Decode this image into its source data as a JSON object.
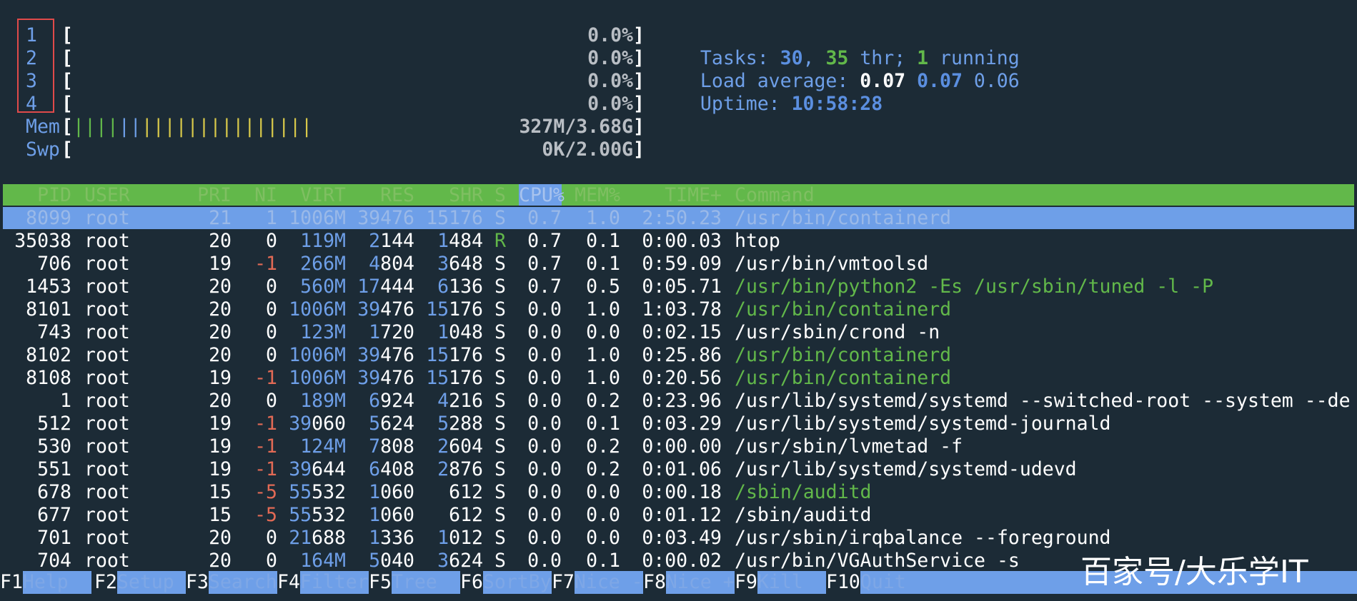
{
  "cpus": [
    {
      "id": "1",
      "usage": "0.0%"
    },
    {
      "id": "2",
      "usage": "0.0%"
    },
    {
      "id": "3",
      "usage": "0.0%"
    },
    {
      "id": "4",
      "usage": "0.0%"
    }
  ],
  "mem": {
    "label": "Mem",
    "bar": "|||||||||||||||||||||",
    "value": "327M/3.68G"
  },
  "swp": {
    "label": "Swp",
    "value": "0K/2.00G"
  },
  "brackets": {
    "open": "[",
    "close": "]"
  },
  "tasks": {
    "label": "Tasks: ",
    "count": "30",
    "sep": ", ",
    "thr": "35",
    "thr_label": " thr; ",
    "running": "1",
    "running_label": " running"
  },
  "load": {
    "label": "Load average: ",
    "v1": "0.07",
    "v2": "0.07",
    "v3": "0.06"
  },
  "uptime": {
    "label": "Uptime: ",
    "value": "10:58:28"
  },
  "columns": {
    "pid": "PID",
    "user": "USER",
    "pri": "PRI",
    "ni": "NI",
    "virt": "VIRT",
    "res": "RES",
    "shr": "SHR",
    "s": "S",
    "cpu": "CPU%",
    "mem": "MEM%",
    "time": "TIME+",
    "command": "Command"
  },
  "processes": [
    {
      "pid": "8099",
      "user": "root",
      "pri": "21",
      "ni": "1",
      "virt": "1006M",
      "res": "39476",
      "shr": "15176",
      "s": "S",
      "cpu": "0.7",
      "mem": "1.0",
      "time": "2:50.23",
      "command": "/usr/bin/containerd"
    },
    {
      "pid": "35038",
      "user": "root",
      "pri": "20",
      "ni": "0",
      "virt": "119M",
      "res": "2144",
      "shr": "1484",
      "s": "R",
      "cpu": "0.7",
      "mem": "0.1",
      "time": "0:00.03",
      "command": "htop"
    },
    {
      "pid": "706",
      "user": "root",
      "pri": "19",
      "ni": "-1",
      "virt": "266M",
      "res": "4804",
      "shr": "3648",
      "s": "S",
      "cpu": "0.7",
      "mem": "0.1",
      "time": "0:59.09",
      "command": "/usr/bin/vmtoolsd"
    },
    {
      "pid": "1453",
      "user": "root",
      "pri": "20",
      "ni": "0",
      "virt": "560M",
      "res": "17444",
      "shr": "6136",
      "s": "S",
      "cpu": "0.7",
      "mem": "0.5",
      "time": "0:05.71",
      "command": "/usr/bin/python2 -Es /usr/sbin/tuned -l -P"
    },
    {
      "pid": "8101",
      "user": "root",
      "pri": "20",
      "ni": "0",
      "virt": "1006M",
      "res": "39476",
      "shr": "15176",
      "s": "S",
      "cpu": "0.0",
      "mem": "1.0",
      "time": "1:03.78",
      "command": "/usr/bin/containerd"
    },
    {
      "pid": "743",
      "user": "root",
      "pri": "20",
      "ni": "0",
      "virt": "123M",
      "res": "1720",
      "shr": "1048",
      "s": "S",
      "cpu": "0.0",
      "mem": "0.0",
      "time": "0:02.15",
      "command": "/usr/sbin/crond -n"
    },
    {
      "pid": "8102",
      "user": "root",
      "pri": "20",
      "ni": "0",
      "virt": "1006M",
      "res": "39476",
      "shr": "15176",
      "s": "S",
      "cpu": "0.0",
      "mem": "1.0",
      "time": "0:25.86",
      "command": "/usr/bin/containerd"
    },
    {
      "pid": "8108",
      "user": "root",
      "pri": "19",
      "ni": "-1",
      "virt": "1006M",
      "res": "39476",
      "shr": "15176",
      "s": "S",
      "cpu": "0.0",
      "mem": "1.0",
      "time": "0:20.56",
      "command": "/usr/bin/containerd"
    },
    {
      "pid": "1",
      "user": "root",
      "pri": "20",
      "ni": "0",
      "virt": "189M",
      "res": "6924",
      "shr": "4216",
      "s": "S",
      "cpu": "0.0",
      "mem": "0.2",
      "time": "0:23.96",
      "command": "/usr/lib/systemd/systemd --switched-root --system --de"
    },
    {
      "pid": "512",
      "user": "root",
      "pri": "19",
      "ni": "-1",
      "virt": "39060",
      "res": "5624",
      "shr": "5288",
      "s": "S",
      "cpu": "0.0",
      "mem": "0.1",
      "time": "0:03.29",
      "command": "/usr/lib/systemd/systemd-journald"
    },
    {
      "pid": "530",
      "user": "root",
      "pri": "19",
      "ni": "-1",
      "virt": "124M",
      "res": "7808",
      "shr": "2604",
      "s": "S",
      "cpu": "0.0",
      "mem": "0.2",
      "time": "0:00.00",
      "command": "/usr/sbin/lvmetad -f"
    },
    {
      "pid": "551",
      "user": "root",
      "pri": "19",
      "ni": "-1",
      "virt": "39644",
      "res": "6408",
      "shr": "2876",
      "s": "S",
      "cpu": "0.0",
      "mem": "0.2",
      "time": "0:01.06",
      "command": "/usr/lib/systemd/systemd-udevd"
    },
    {
      "pid": "678",
      "user": "root",
      "pri": "15",
      "ni": "-5",
      "virt": "55532",
      "res": "1060",
      "shr": "612",
      "s": "S",
      "cpu": "0.0",
      "mem": "0.0",
      "time": "0:00.18",
      "command": "/sbin/auditd"
    },
    {
      "pid": "677",
      "user": "root",
      "pri": "15",
      "ni": "-5",
      "virt": "55532",
      "res": "1060",
      "shr": "612",
      "s": "S",
      "cpu": "0.0",
      "mem": "0.0",
      "time": "0:01.12",
      "command": "/sbin/auditd"
    },
    {
      "pid": "701",
      "user": "root",
      "pri": "20",
      "ni": "0",
      "virt": "21688",
      "res": "1336",
      "shr": "1012",
      "s": "S",
      "cpu": "0.0",
      "mem": "0.0",
      "time": "0:03.49",
      "command": "/usr/sbin/irqbalance --foreground"
    },
    {
      "pid": "704",
      "user": "root",
      "pri": "20",
      "ni": "0",
      "virt": "164M",
      "res": "5040",
      "shr": "3624",
      "s": "S",
      "cpu": "0.0",
      "mem": "0.1",
      "time": "0:00.02",
      "command": "/usr/bin/VGAuthService -s"
    }
  ],
  "function_keys": [
    {
      "key": "F1",
      "label": "Help  "
    },
    {
      "key": "F2",
      "label": "Setup "
    },
    {
      "key": "F3",
      "label": "Search"
    },
    {
      "key": "F4",
      "label": "Filter"
    },
    {
      "key": "F5",
      "label": "Tree  "
    },
    {
      "key": "F6",
      "label": "SortBy"
    },
    {
      "key": "F7",
      "label": "Nice -"
    },
    {
      "key": "F8",
      "label": "Nice +"
    },
    {
      "key": "F9",
      "label": "Kill  "
    },
    {
      "key": "F10",
      "label": "Quit"
    }
  ],
  "watermark": "百家号/大乐学IT"
}
